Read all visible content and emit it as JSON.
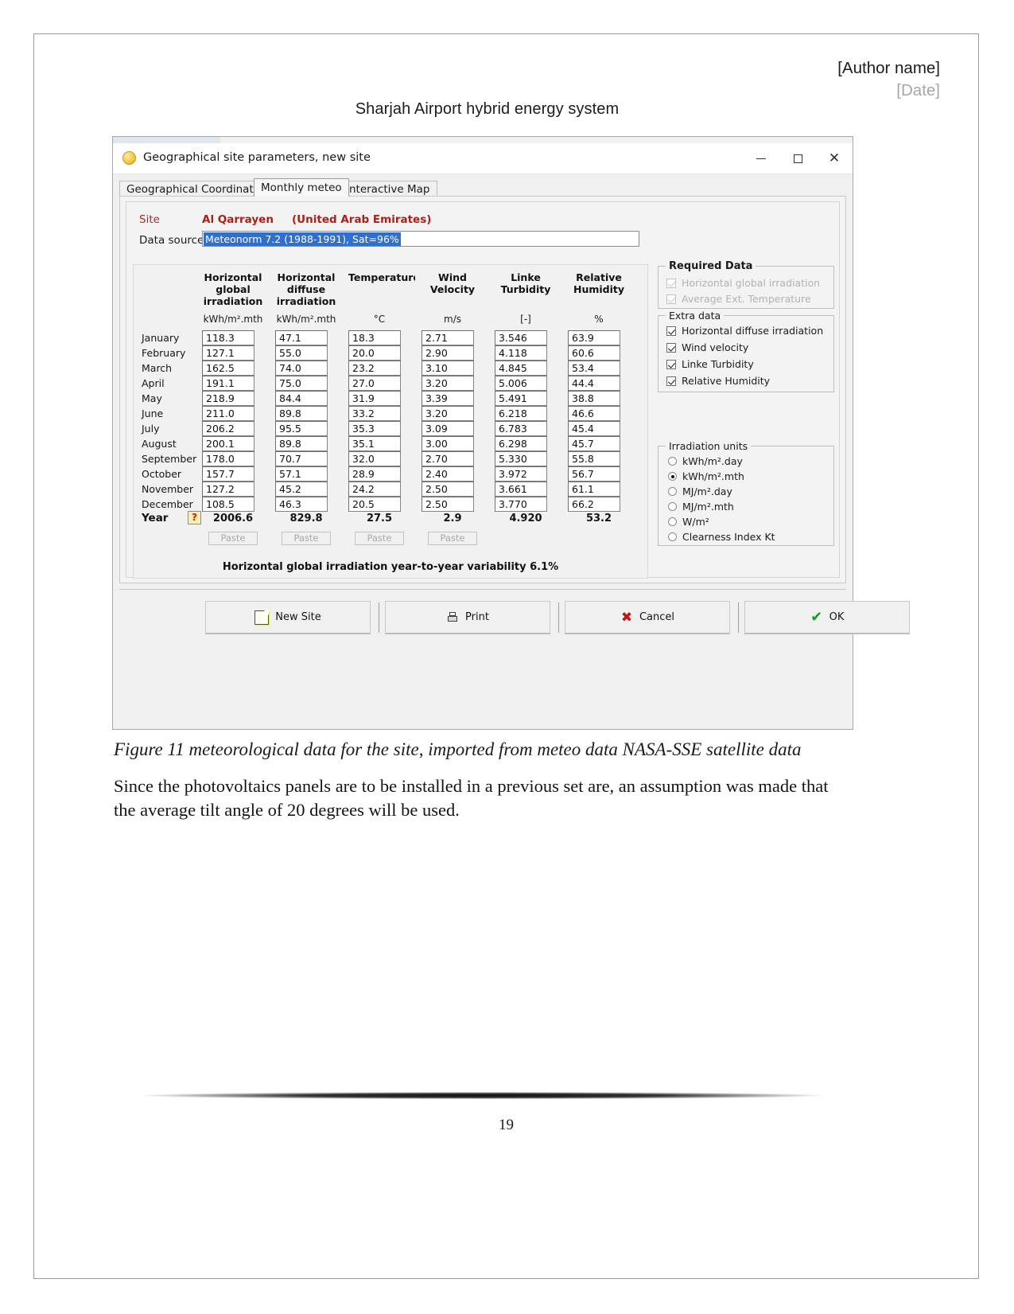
{
  "document": {
    "author": "[Author name]",
    "date": "[Date]",
    "title": "Sharjah Airport hybrid energy system",
    "figure_caption": "Figure 11 meteorological data for the site, imported from meteo data NASA-SSE satellite data",
    "body_paragraph": "Since the photovoltaics panels are to be installed in a previous set are, an assumption was made that the average tilt angle of 20 degrees will be used.",
    "page_number": "19"
  },
  "dialog": {
    "title": "Geographical site parameters, new site",
    "title_icon": "globe-icon",
    "window_controls": {
      "minimize": "—",
      "maximize": "□",
      "close": "✕"
    },
    "tabs": [
      {
        "label": "Geographical Coordinates",
        "selected": false
      },
      {
        "label": "Monthly meteo",
        "selected": true
      },
      {
        "label": "Interactive Map",
        "selected": false
      }
    ],
    "site": {
      "label": "Site",
      "name": "Al Qarrayen",
      "country": "(United Arab Emirates)"
    },
    "data_source": {
      "label": "Data source",
      "value": "Meteonorm 7.2 (1988-1991), Sat=96%",
      "selection_color": "#2f6fd0"
    },
    "table": {
      "columns": [
        {
          "header": "Horizontal global irradiation",
          "unit": "kWh/m².mth"
        },
        {
          "header": "Horizontal diffuse irradiation",
          "unit": "kWh/m².mth"
        },
        {
          "header": "Temperature",
          "unit": "°C"
        },
        {
          "header": "Wind Velocity",
          "unit": "m/s"
        },
        {
          "header": "Linke Turbidity",
          "unit": "[-]"
        },
        {
          "header": "Relative Humidity",
          "unit": "%"
        }
      ],
      "rows": [
        {
          "month": "January",
          "values": [
            "118.3",
            "47.1",
            "18.3",
            "2.71",
            "3.546",
            "63.9"
          ]
        },
        {
          "month": "February",
          "values": [
            "127.1",
            "55.0",
            "20.0",
            "2.90",
            "4.118",
            "60.6"
          ]
        },
        {
          "month": "March",
          "values": [
            "162.5",
            "74.0",
            "23.2",
            "3.10",
            "4.845",
            "53.4"
          ]
        },
        {
          "month": "April",
          "values": [
            "191.1",
            "75.0",
            "27.0",
            "3.20",
            "5.006",
            "44.4"
          ]
        },
        {
          "month": "May",
          "values": [
            "218.9",
            "84.4",
            "31.9",
            "3.39",
            "5.491",
            "38.8"
          ]
        },
        {
          "month": "June",
          "values": [
            "211.0",
            "89.8",
            "33.2",
            "3.20",
            "6.218",
            "46.6"
          ]
        },
        {
          "month": "July",
          "values": [
            "206.2",
            "95.5",
            "35.3",
            "3.09",
            "6.783",
            "45.4"
          ]
        },
        {
          "month": "August",
          "values": [
            "200.1",
            "89.8",
            "35.1",
            "3.00",
            "6.298",
            "45.7"
          ]
        },
        {
          "month": "September",
          "values": [
            "178.0",
            "70.7",
            "32.0",
            "2.70",
            "5.330",
            "55.8"
          ]
        },
        {
          "month": "October",
          "values": [
            "157.7",
            "57.1",
            "28.9",
            "2.40",
            "3.972",
            "56.7"
          ]
        },
        {
          "month": "November",
          "values": [
            "127.2",
            "45.2",
            "24.2",
            "2.50",
            "3.661",
            "61.1"
          ]
        },
        {
          "month": "December",
          "values": [
            "108.5",
            "46.3",
            "20.5",
            "2.50",
            "3.770",
            "66.2"
          ]
        }
      ],
      "year": {
        "label": "Year",
        "help_glyph": "?",
        "values": [
          "2006.6",
          "829.8",
          "27.5",
          "2.9",
          "4.920",
          "53.2"
        ]
      },
      "paste_label": "Paste",
      "paste_count": 4,
      "variability_text": "Horizontal global irradiation year-to-year variability  6.1%"
    },
    "required_data": {
      "legend": "Required Data",
      "items": [
        {
          "label": "Horizontal global irradiation",
          "checked": true,
          "enabled": false
        },
        {
          "label": "Average Ext. Temperature",
          "checked": true,
          "enabled": false
        }
      ]
    },
    "extra_data": {
      "legend": "Extra data",
      "items": [
        {
          "label": "Horizontal diffuse irradiation",
          "checked": true,
          "enabled": true
        },
        {
          "label": "Wind velocity",
          "checked": true,
          "enabled": true
        },
        {
          "label": "Linke Turbidity",
          "checked": true,
          "enabled": true
        },
        {
          "label": "Relative Humidity",
          "checked": true,
          "enabled": true
        }
      ]
    },
    "irradiation_units": {
      "legend": "Irradiation units",
      "options": [
        {
          "label": "kWh/m².day",
          "selected": false
        },
        {
          "label": "kWh/m².mth",
          "selected": true
        },
        {
          "label": "MJ/m².day",
          "selected": false
        },
        {
          "label": "MJ/m².mth",
          "selected": false
        },
        {
          "label": "W/m²",
          "selected": false
        },
        {
          "label": "Clearness Index Kt",
          "selected": false
        }
      ]
    },
    "buttons": [
      {
        "label": "New Site",
        "icon": "new-page-icon"
      },
      {
        "label": "Print",
        "icon": "printer-icon"
      },
      {
        "label": "Cancel",
        "icon": "x-icon",
        "color": "#c01818"
      },
      {
        "label": "OK",
        "icon": "check-icon",
        "color": "#19992a"
      }
    ]
  }
}
